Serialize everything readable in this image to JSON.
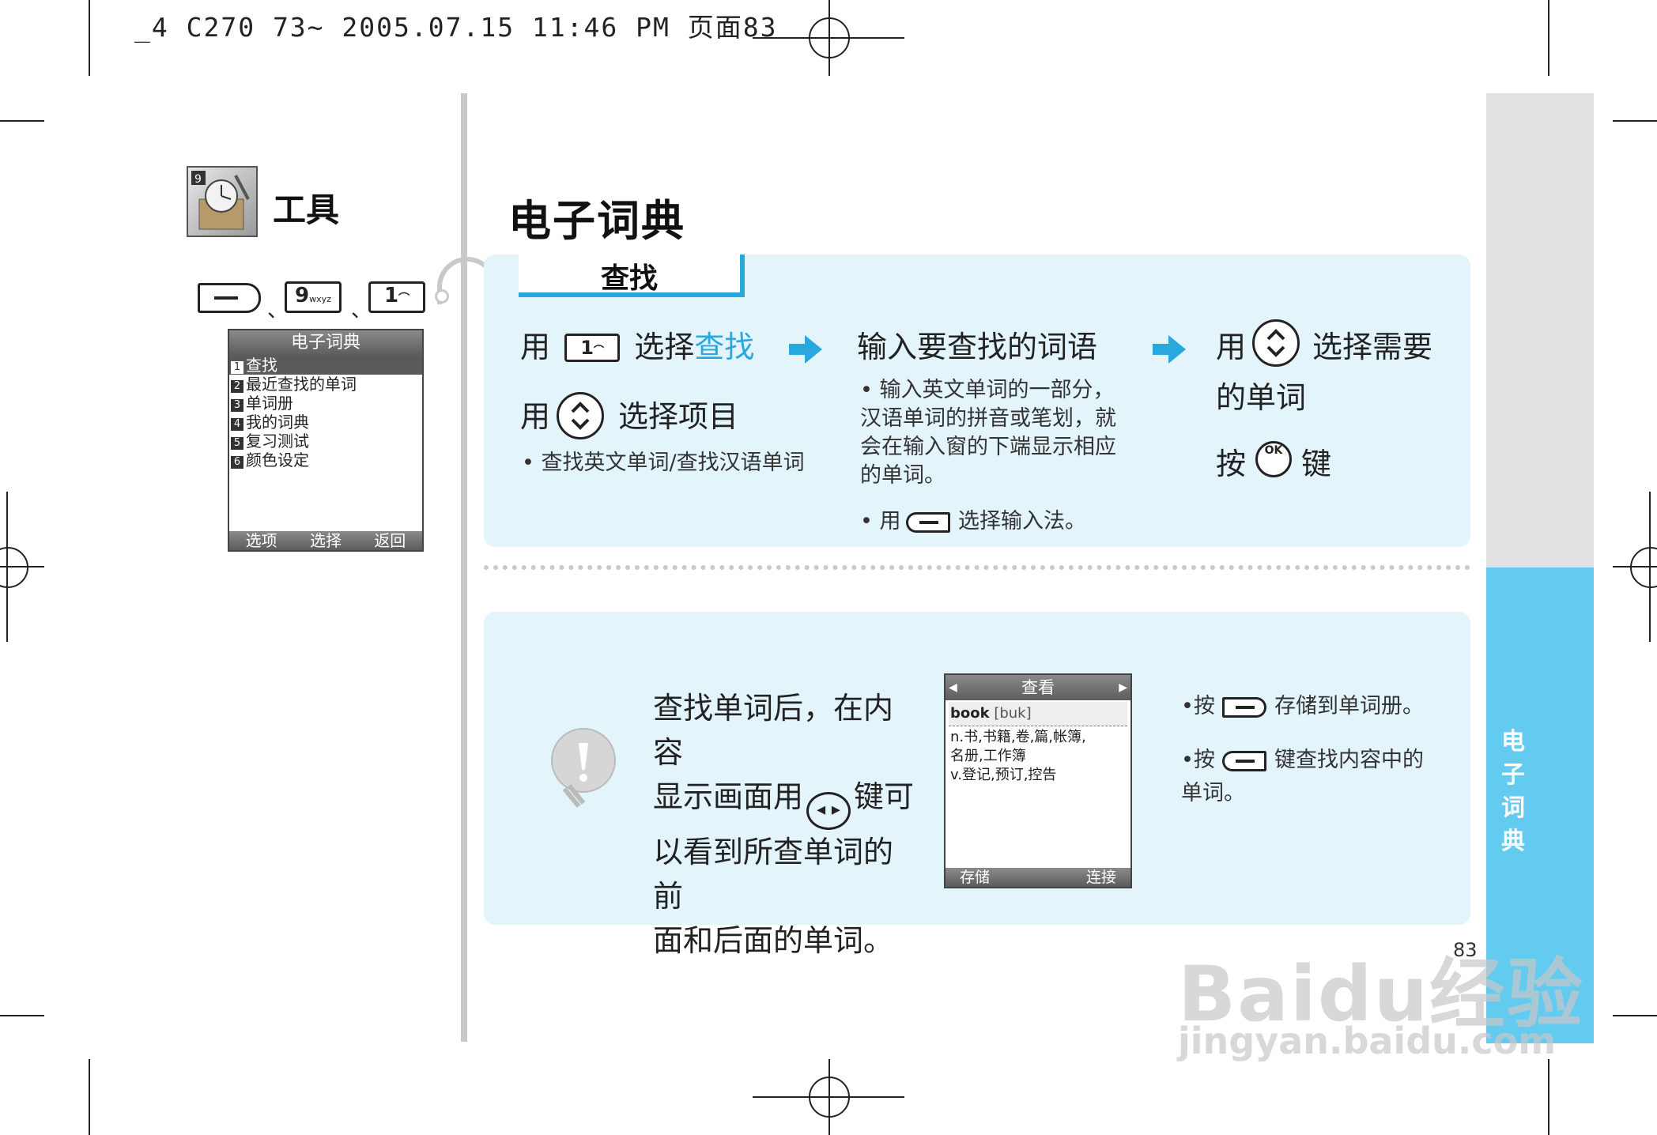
{
  "print_header": "_4 C270 73~ 2005.07.15 11:46 PM 页面83",
  "section": {
    "title": "工具",
    "keys": [
      "9",
      "1"
    ],
    "key_sub": [
      "wxyz",
      ""
    ],
    "separators": [
      "、",
      "、"
    ]
  },
  "phone_menu": {
    "title": "电子词典",
    "items": [
      {
        "num": "1",
        "label": "查找"
      },
      {
        "num": "2",
        "label": "最近查找的单词"
      },
      {
        "num": "3",
        "label": "单词册"
      },
      {
        "num": "4",
        "label": "我的词典"
      },
      {
        "num": "5",
        "label": "复习测试"
      },
      {
        "num": "6",
        "label": "颜色设定"
      }
    ],
    "softkeys": [
      "选项",
      "选择",
      "返回"
    ]
  },
  "main_title": "电子词典",
  "panel1": {
    "tab": "查找",
    "step1": {
      "line1_prefix": "用",
      "key": "1",
      "line1_suffix": "选择",
      "line1_highlight": "查找",
      "line2_prefix": "用",
      "line2_suffix": "选择项目",
      "bullet": "查找英文单词/查找汉语单词"
    },
    "step2": {
      "title": "输入要查找的词语",
      "bullet1": "输入英文单词的一部分，汉语单词的拼音或笔划，就会在输入窗的下端显示相应的单词。",
      "bullet2_prefix": "用",
      "bullet2_suffix": "选择输入法。"
    },
    "step3": {
      "line1_prefix": "用",
      "line1_suffix": "选择需要",
      "line2": "的单词",
      "line3_prefix": "按",
      "ok_label": "OK",
      "line3_suffix": "键"
    }
  },
  "panel2": {
    "tip": "查找单词后，在内容显示画面用 键可以看到所查单词的前面和后面的单词。",
    "tip_parts": [
      "查找单词后，在内容",
      "显示画面用",
      "键可",
      "以看到所查单词的前",
      "面和后面的单词。"
    ],
    "phone": {
      "title": "查看",
      "word": "book",
      "phonetic": "[buk]",
      "defs": [
        "n.书,书籍,卷,篇,帐簿,",
        "名册,工作簿",
        "v.登记,预订,控告"
      ],
      "softkeys": [
        "存储",
        "连接"
      ]
    },
    "note1_prefix": "•按",
    "note1_suffix": "存储到单词册。",
    "note2_prefix": "•按",
    "note2_suffix": "键查找内容中的",
    "note2_line2": "单词。"
  },
  "side_tab": [
    "电",
    "子",
    "词",
    "典"
  ],
  "page_number": "83",
  "watermark": {
    "line1": "Baidu经验",
    "line2": "jingyan.baidu.com"
  },
  "colors": {
    "accent": "#29a8de",
    "panel_bg": "#e3f4fb",
    "side_blue": "#63caf0",
    "side_gray": "#e2e2e2"
  }
}
